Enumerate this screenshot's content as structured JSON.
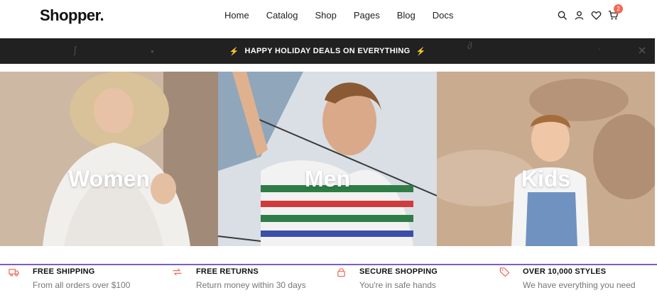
{
  "header": {
    "logo": "Shopper.",
    "nav": [
      "Home",
      "Catalog",
      "Shop",
      "Pages",
      "Blog",
      "Docs"
    ],
    "icons": [
      "search-icon",
      "user-icon",
      "heart-icon",
      "cart-icon"
    ],
    "cart_count": "2"
  },
  "promo": {
    "text": "HAPPY HOLIDAY DEALS ON EVERYTHING",
    "icon": "lightning-icon",
    "accent": "#f5a623",
    "background": "#212121"
  },
  "categories": [
    {
      "label": "Women"
    },
    {
      "label": "Men"
    },
    {
      "label": "Kids"
    }
  ],
  "features": [
    {
      "icon": "truck-icon",
      "title": "FREE SHIPPING",
      "subtitle": "From all orders over $100"
    },
    {
      "icon": "refresh-icon",
      "title": "FREE RETURNS",
      "subtitle": "Return money within 30 days"
    },
    {
      "icon": "lock-icon",
      "title": "SECURE SHOPPING",
      "subtitle": "You're in safe hands"
    },
    {
      "icon": "tag-icon",
      "title": "OVER 10,000 STYLES",
      "subtitle": "We have everything you need"
    }
  ],
  "colors": {
    "accent": "#f06a56",
    "divider": "#7a5fc0"
  }
}
